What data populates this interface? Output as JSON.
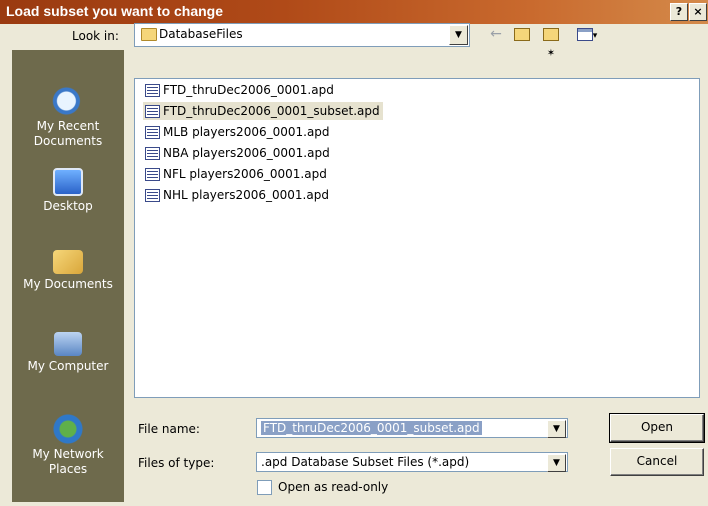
{
  "window": {
    "title": "Load subset you want to change",
    "help_label": "?",
    "close_label": "×"
  },
  "look_in": {
    "label": "Look in:",
    "value": "DatabaseFiles"
  },
  "places": [
    {
      "label": "My Recent Documents",
      "icon": "recent-documents-icon"
    },
    {
      "label": "Desktop",
      "icon": "desktop-icon"
    },
    {
      "label": "My Documents",
      "icon": "my-documents-icon"
    },
    {
      "label": "My Computer",
      "icon": "my-computer-icon"
    },
    {
      "label": "My Network Places",
      "icon": "network-places-icon"
    }
  ],
  "files": [
    {
      "name": "FTD_thruDec2006_0001.apd"
    },
    {
      "name": "FTD_thruDec2006_0001_subset.apd",
      "selected": true
    },
    {
      "name": "MLB players2006_0001.apd"
    },
    {
      "name": "NBA players2006_0001.apd"
    },
    {
      "name": "NFL players2006_0001.apd"
    },
    {
      "name": "NHL players2006_0001.apd"
    }
  ],
  "file_name": {
    "label": "File name:",
    "value": "FTD_thruDec2006_0001_subset.apd"
  },
  "file_type": {
    "label": "Files of type:",
    "value": ".apd Database Subset Files (*.apd)"
  },
  "read_only": {
    "label": "Open as read-only",
    "checked": false
  },
  "buttons": {
    "open": "Open",
    "cancel": "Cancel"
  }
}
